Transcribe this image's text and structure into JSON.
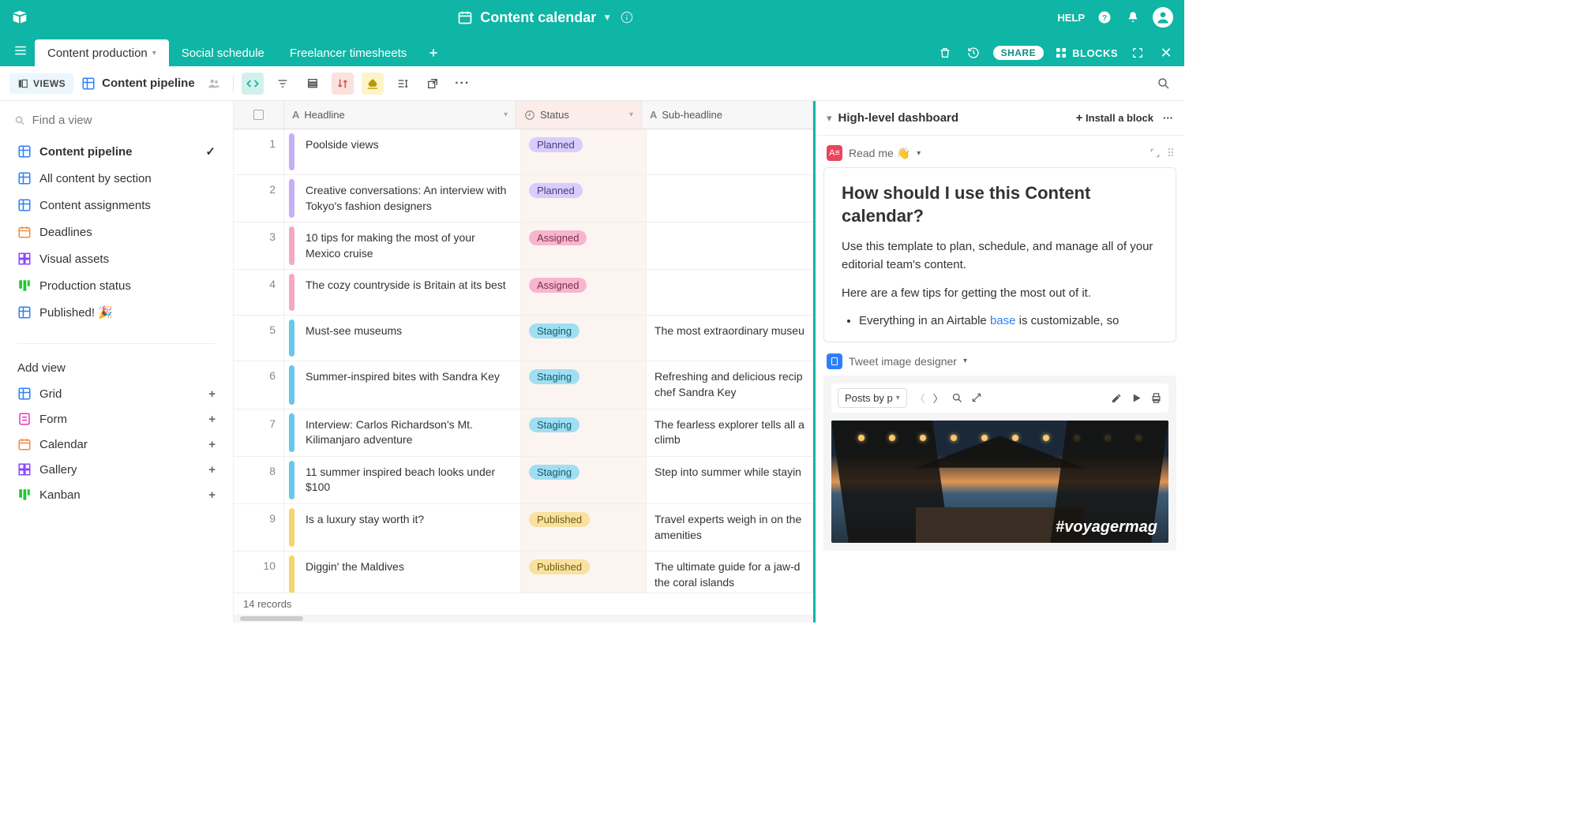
{
  "header": {
    "base_name": "Content calendar",
    "help": "HELP"
  },
  "tabs": [
    {
      "label": "Content production",
      "active": true
    },
    {
      "label": "Social schedule",
      "active": false
    },
    {
      "label": "Freelancer timesheets",
      "active": false
    }
  ],
  "tabrow": {
    "share": "SHARE",
    "blocks": "BLOCKS"
  },
  "viewbar": {
    "views_button": "VIEWS",
    "view_name": "Content pipeline"
  },
  "sidebar": {
    "find_placeholder": "Find a view",
    "views": [
      {
        "label": "Content pipeline",
        "icon": "grid",
        "active": true
      },
      {
        "label": "All content by section",
        "icon": "grid"
      },
      {
        "label": "Content assignments",
        "icon": "grid"
      },
      {
        "label": "Deadlines",
        "icon": "calendar"
      },
      {
        "label": "Visual assets",
        "icon": "gallery"
      },
      {
        "label": "Production status",
        "icon": "kanban"
      },
      {
        "label": "Published! 🎉",
        "icon": "grid"
      }
    ],
    "add_view_header": "Add view",
    "add_views": [
      {
        "label": "Grid",
        "icon": "grid"
      },
      {
        "label": "Form",
        "icon": "form"
      },
      {
        "label": "Calendar",
        "icon": "calendar"
      },
      {
        "label": "Gallery",
        "icon": "gallery"
      },
      {
        "label": "Kanban",
        "icon": "kanban"
      }
    ]
  },
  "grid": {
    "columns": {
      "headline": "Headline",
      "status": "Status",
      "sub": "Sub-headline"
    },
    "rows": [
      {
        "n": "1",
        "color": "purple",
        "headline": "Poolside views",
        "status": "Planned",
        "sub": ""
      },
      {
        "n": "2",
        "color": "purple",
        "headline": "Creative conversations: An interview with Tokyo's fashion designers",
        "status": "Planned",
        "sub": ""
      },
      {
        "n": "3",
        "color": "pink",
        "headline": "10 tips for making the most of your Mexico cruise",
        "status": "Assigned",
        "sub": ""
      },
      {
        "n": "4",
        "color": "pink",
        "headline": "The cozy countryside is Britain at its best",
        "status": "Assigned",
        "sub": ""
      },
      {
        "n": "5",
        "color": "blue",
        "headline": "Must-see museums",
        "status": "Staging",
        "sub": "The most extraordinary museu"
      },
      {
        "n": "6",
        "color": "blue",
        "headline": "Summer-inspired bites with Sandra Key",
        "status": "Staging",
        "sub": "Refreshing and delicious recip chef Sandra Key"
      },
      {
        "n": "7",
        "color": "blue",
        "headline": "Interview: Carlos Richardson's Mt. Kilimanjaro adventure",
        "status": "Staging",
        "sub": "The fearless explorer tells all a climb"
      },
      {
        "n": "8",
        "color": "blue",
        "headline": "11 summer inspired beach looks under $100",
        "status": "Staging",
        "sub": "Step into summer while stayin"
      },
      {
        "n": "9",
        "color": "yellow",
        "headline": "Is a luxury stay worth it?",
        "status": "Published",
        "sub": "Travel experts weigh in on the amenities"
      },
      {
        "n": "10",
        "color": "yellow",
        "headline": "Diggin' the Maldives",
        "status": "Published",
        "sub": "The ultimate guide for a jaw-d the coral islands"
      }
    ],
    "footer": "14 records"
  },
  "dashboard": {
    "title": "High-level dashboard",
    "install": "Install a block",
    "block1": {
      "name": "Read me 👋",
      "heading": "How should I use this Content calendar?",
      "p1": "Use this template to plan, schedule, and manage all of your editorial team's content.",
      "p2": "Here are a few tips for getting the most out of it.",
      "li1_pre": "Everything in an Airtable ",
      "li1_link": "base",
      "li1_post": " is customizable, so"
    },
    "block2": {
      "name": "Tweet image designer",
      "selector": "Posts by p",
      "hashtag": "#voyagermag"
    }
  },
  "status_pill_class": {
    "Planned": "pill-planned",
    "Assigned": "pill-assigned",
    "Staging": "pill-staging",
    "Published": "pill-published"
  },
  "color_bar_class": {
    "purple": "cb-purple",
    "pink": "cb-pink",
    "blue": "cb-blue",
    "yellow": "cb-yellow"
  },
  "view_icon_class": {
    "grid": "vic-grid",
    "calendar": "vic-cal",
    "kanban": "vic-kanban",
    "gallery": "vic-gallery",
    "form": "vic-form"
  }
}
